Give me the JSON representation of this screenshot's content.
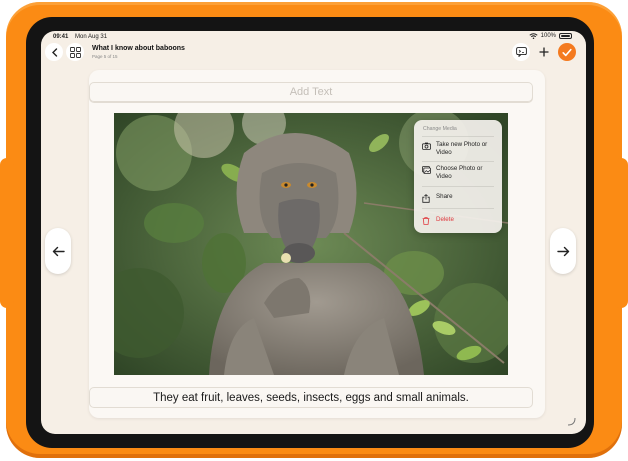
{
  "status": {
    "time": "09:41",
    "date": "Mon Aug 31",
    "battery": "100%"
  },
  "document": {
    "title": "What I know about baboons",
    "page_indicator": "Page 5 of 15"
  },
  "card": {
    "add_text_placeholder": "Add Text",
    "caption": "They eat fruit, leaves, seeds, insects, eggs and small animals."
  },
  "context_menu": {
    "header": "Change Media",
    "items": [
      {
        "label": "Take new Photo or Video",
        "icon": "camera-icon"
      },
      {
        "label": "Choose Photo or Video",
        "icon": "photo-library-icon"
      },
      {
        "label": "Share",
        "icon": "share-icon"
      },
      {
        "label": "Delete",
        "icon": "trash-icon",
        "color": "#e0393e"
      }
    ]
  },
  "colors": {
    "case": "#fb8b14",
    "accent": "#f47a1f",
    "screen_bg": "#f6efe6",
    "delete": "#e0393e"
  }
}
